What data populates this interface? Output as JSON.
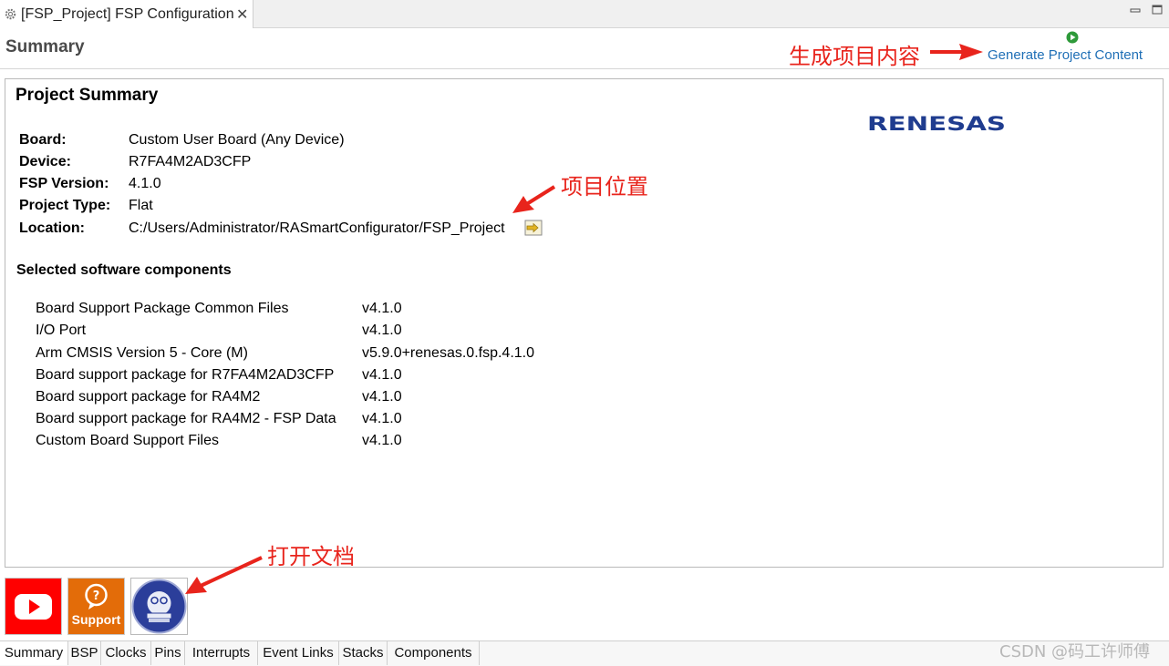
{
  "editor_tab": {
    "title": "[FSP_Project] FSP Configuration",
    "close": "✕"
  },
  "header": {
    "title": "Summary",
    "generate_link": "Generate Project Content"
  },
  "panel": {
    "title": "Project Summary",
    "logo_text": "RENESAS",
    "info": [
      {
        "label": "Board:",
        "value": "Custom User Board (Any Device)"
      },
      {
        "label": "Device:",
        "value": "R7FA4M2AD3CFP"
      },
      {
        "label": "FSP Version:",
        "value": "4.1.0"
      },
      {
        "label": "Project Type:",
        "value": "Flat"
      },
      {
        "label": "Location:",
        "value": "C:/Users/Administrator/RASmartConfigurator/FSP_Project"
      }
    ],
    "components_title": "Selected software components",
    "components": [
      {
        "name": "Board Support Package Common Files",
        "version": "v4.1.0"
      },
      {
        "name": "I/O Port",
        "version": "v4.1.0"
      },
      {
        "name": "Arm CMSIS Version 5 - Core (M)",
        "version": "v5.9.0+renesas.0.fsp.4.1.0"
      },
      {
        "name": "Board support package for R7FA4M2AD3CFP",
        "version": "v4.1.0"
      },
      {
        "name": "Board support package for RA4M2",
        "version": "v4.1.0"
      },
      {
        "name": "Board support package for RA4M2 - FSP Data",
        "version": "v4.1.0"
      },
      {
        "name": "Custom Board Support Files",
        "version": "v4.1.0"
      }
    ]
  },
  "annotations": {
    "generate": "生成项目内容",
    "location": "项目位置",
    "docs": "打开文档"
  },
  "tiles": {
    "support_label": "Support"
  },
  "bottom_tabs": [
    "Summary",
    "BSP",
    "Clocks",
    "Pins",
    "Interrupts",
    "Event Links",
    "Stacks",
    "Components"
  ],
  "active_tab": "Summary",
  "watermark": "CSDN @码工许师傅",
  "colors": {
    "link": "#1f6fb6",
    "annotation": "#e8241c",
    "renesas": "#1f3c8f",
    "youtube": "#ff0000",
    "support": "#e36c09"
  }
}
